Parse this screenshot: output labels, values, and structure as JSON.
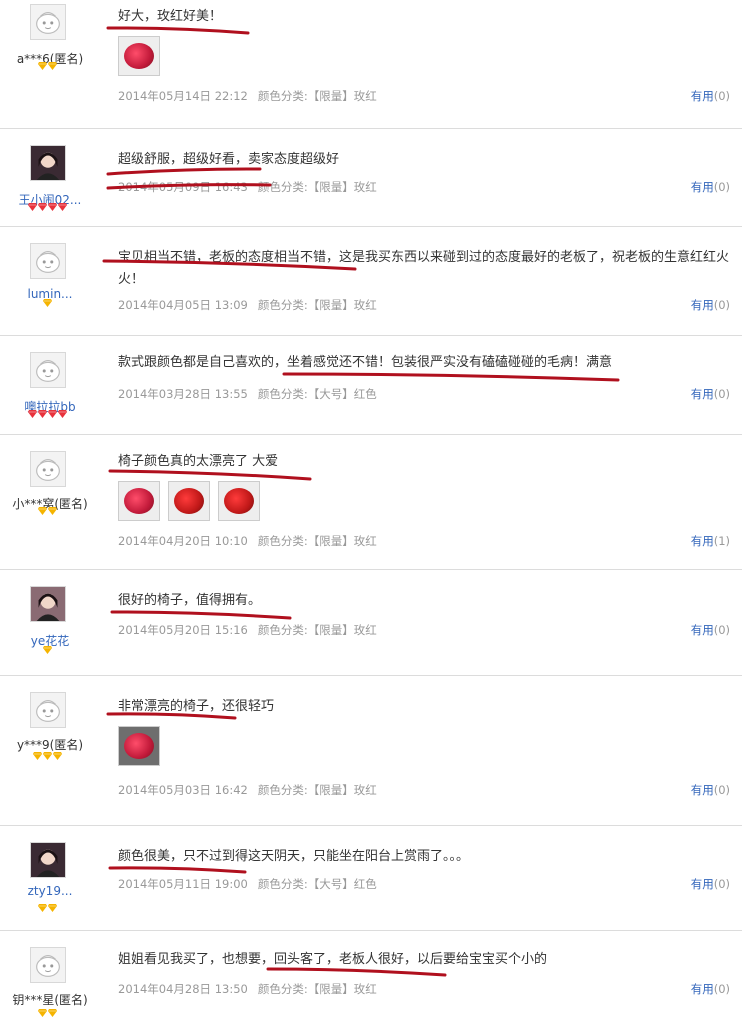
{
  "reviews": [
    {
      "user": "a***6(匿名)",
      "anon": true,
      "avatar": "default",
      "rank": 2,
      "rank_type": "gold",
      "text": "好大，玫红好美！",
      "date": "2014年05月14日 22:12",
      "variant_label": "颜色分类:",
      "variant": "【限量】玫红",
      "useful_label": "有用",
      "useful_count": "(0)",
      "thumbs": [
        "pink"
      ]
    },
    {
      "user": "王小闹02...",
      "anon": false,
      "avatar": "photo",
      "rank": 4,
      "rank_type": "red",
      "text": "超级舒服，超级好看，卖家态度超级好",
      "date": "2014年05月09日 16:43",
      "variant_label": "颜色分类:",
      "variant": "【限量】玫红",
      "useful_label": "有用",
      "useful_count": "(0)",
      "thumbs": []
    },
    {
      "user": "lumin...",
      "anon": false,
      "avatar": "default",
      "rank": 1,
      "rank_type": "gold",
      "text": "宝贝相当不错，老板的态度相当不错，这是我买东西以来碰到过的态度最好的老板了，祝老板的生意红红火火！",
      "date": "2014年04月05日 13:09",
      "variant_label": "颜色分类:",
      "variant": "【限量】玫红",
      "useful_label": "有用",
      "useful_count": "(0)",
      "thumbs": []
    },
    {
      "user": "噢拉拉bb",
      "anon": false,
      "avatar": "default",
      "rank": 4,
      "rank_type": "red",
      "text": "款式跟颜色都是自己喜欢的，坐着感觉还不错！包装很严实没有磕磕碰碰的毛病！满意",
      "date": "2014年03月28日 13:55",
      "variant_label": "颜色分类:",
      "variant": "【大号】红色",
      "useful_label": "有用",
      "useful_count": "(0)",
      "thumbs": []
    },
    {
      "user": "小***窝(匿名)",
      "anon": true,
      "avatar": "default",
      "rank": 2,
      "rank_type": "gold",
      "text": "椅子颜色真的太漂亮了 大爱",
      "date": "2014年04月20日 10:10",
      "variant_label": "颜色分类:",
      "variant": "【限量】玫红",
      "useful_label": "有用",
      "useful_count": "(1)",
      "thumbs": [
        "pink",
        "red",
        "red"
      ]
    },
    {
      "user": "ye花花",
      "anon": false,
      "avatar": "photo",
      "rank": 1,
      "rank_type": "gold",
      "text": "很好的椅子，值得拥有。",
      "date": "2014年05月20日 15:16",
      "variant_label": "颜色分类:",
      "variant": "【限量】玫红",
      "useful_label": "有用",
      "useful_count": "(0)",
      "thumbs": []
    },
    {
      "user": "y***9(匿名)",
      "anon": true,
      "avatar": "default",
      "rank": 3,
      "rank_type": "gold",
      "text": "非常漂亮的椅子，还很轻巧",
      "date": "2014年05月03日 16:42",
      "variant_label": "颜色分类:",
      "variant": "【限量】玫红",
      "useful_label": "有用",
      "useful_count": "(0)",
      "thumbs": [
        "photo"
      ]
    },
    {
      "user": "zty19...",
      "anon": false,
      "avatar": "photo",
      "rank": 2,
      "rank_type": "gold",
      "text": "颜色很美，只不过到得这天阴天，只能坐在阳台上赏雨了。。。",
      "date": "2014年05月11日 19:00",
      "variant_label": "颜色分类:",
      "variant": "【大号】红色",
      "useful_label": "有用",
      "useful_count": "(0)",
      "thumbs": []
    },
    {
      "user": "钥***星(匿名)",
      "anon": true,
      "avatar": "default",
      "rank": 2,
      "rank_type": "gold",
      "text": "姐姐看见我买了，也想要，回头客了，老板人很好，以后要给宝宝买个小的",
      "date": "2014年04月28日 13:50",
      "variant_label": "颜色分类:",
      "variant": "【限量】玫红",
      "useful_label": "有用",
      "useful_count": "(0)",
      "thumbs": []
    }
  ],
  "colors": {
    "link": "#3366bb",
    "meta": "#999999",
    "ink": "#b0101e",
    "gold_gem": "#f5b400",
    "red_gem": "#e8323c"
  }
}
